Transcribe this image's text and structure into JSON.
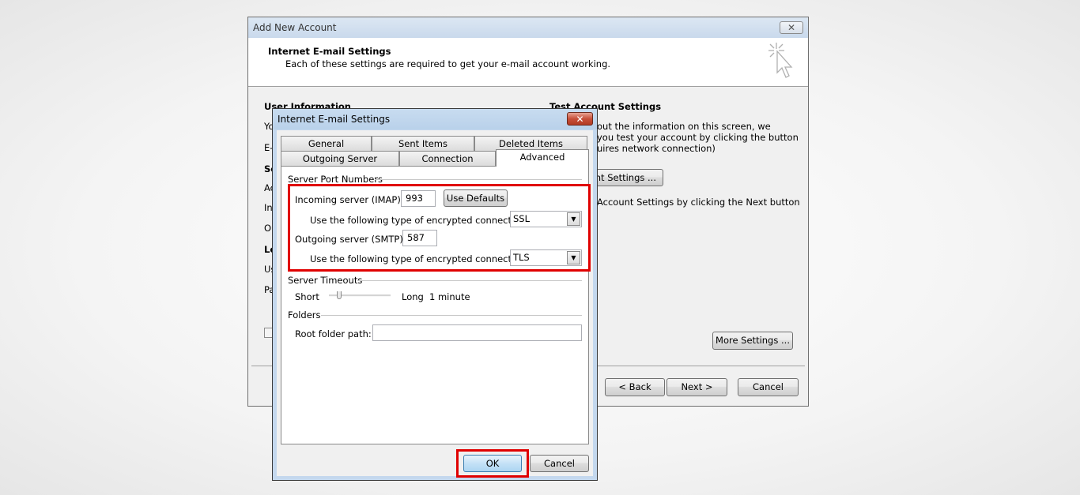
{
  "main_window": {
    "title": "Add New Account",
    "header_title": "Internet E-mail Settings",
    "header_subtitle": "Each of these settings are required to get your e-mail account working.",
    "left_col": {
      "user_info_heading": "User Information",
      "partial_labels": [
        "Yo",
        "E-",
        "Se",
        "Ac",
        "In",
        "Ou",
        "Lo",
        "Us",
        "Pa"
      ]
    },
    "right_col": {
      "test_heading": "Test Account Settings",
      "line1": "out the information on this screen, we",
      "line2": "you test your account by clicking the button",
      "line3": "uires network connection)",
      "test_button_label": "unt Settings ...",
      "next_info": "Account Settings by clicking the Next button"
    },
    "more_settings_label": "More Settings ...",
    "back_label": "< Back",
    "next_label": "Next >",
    "cancel_label": "Cancel"
  },
  "dialog": {
    "title": "Internet E-mail Settings",
    "tabs_row1": [
      "General",
      "Sent Items",
      "Deleted Items"
    ],
    "tabs_row2": [
      "Outgoing Server",
      "Connection",
      "Advanced"
    ],
    "active_tab": "Advanced",
    "server_ports": {
      "group_label": "Server Port Numbers",
      "incoming_label": "Incoming server (IMAP):",
      "incoming_value": "993",
      "use_defaults_label": "Use Defaults",
      "incoming_enc_label": "Use the following type of encrypted connection:",
      "incoming_enc_value": "SSL",
      "outgoing_label": "Outgoing server (SMTP):",
      "outgoing_value": "587",
      "outgoing_enc_label": "Use the following type of encrypted connection:",
      "outgoing_enc_value": "TLS"
    },
    "timeouts": {
      "group_label": "Server Timeouts",
      "short_label": "Short",
      "long_label": "Long",
      "value_text": "1 minute",
      "slider_fraction": 0.05
    },
    "folders": {
      "group_label": "Folders",
      "root_label": "Root folder path:",
      "root_value": ""
    },
    "ok_label": "OK",
    "cancel_label": "Cancel"
  },
  "annotation_color": "#e00000"
}
